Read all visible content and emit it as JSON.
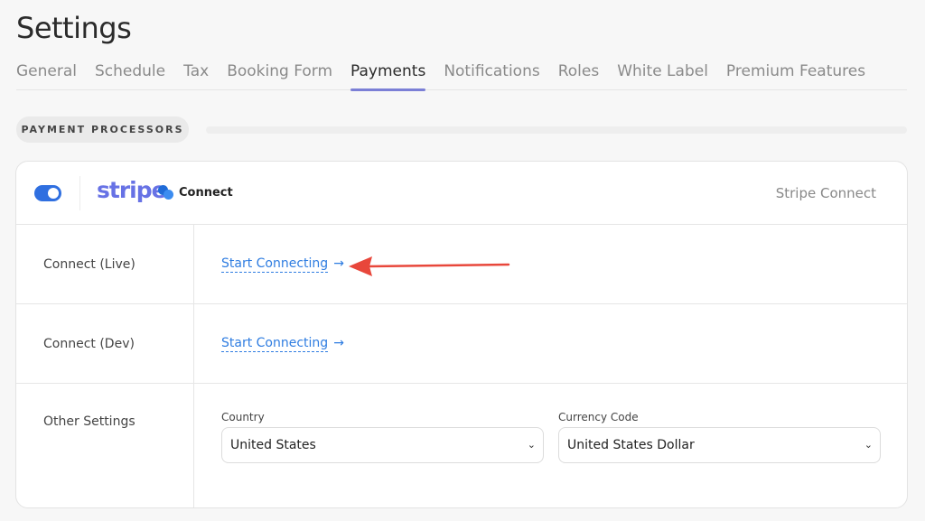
{
  "page": {
    "title": "Settings"
  },
  "tabs": [
    {
      "label": "General",
      "active": false
    },
    {
      "label": "Schedule",
      "active": false
    },
    {
      "label": "Tax",
      "active": false
    },
    {
      "label": "Booking Form",
      "active": false
    },
    {
      "label": "Payments",
      "active": true
    },
    {
      "label": "Notifications",
      "active": false
    },
    {
      "label": "Roles",
      "active": false
    },
    {
      "label": "White Label",
      "active": false
    },
    {
      "label": "Premium Features",
      "active": false
    }
  ],
  "section": {
    "label": "PAYMENT PROCESSORS"
  },
  "processor": {
    "enabled": true,
    "logo_text": "stripe",
    "badge_text": "Connect",
    "name": "Stripe Connect",
    "colors": {
      "logo": "#6772e5",
      "link": "#2f7de1",
      "toggle": "#2f6fe0",
      "annotation_arrow": "#e8473b"
    }
  },
  "rows": {
    "live": {
      "label": "Connect (Live)",
      "link": "Start Connecting",
      "arrow": "→"
    },
    "dev": {
      "label": "Connect (Dev)",
      "link": "Start Connecting",
      "arrow": "→"
    },
    "other": {
      "label": "Other Settings",
      "country": {
        "label": "Country",
        "value": "United States"
      },
      "currency": {
        "label": "Currency Code",
        "value": "United States Dollar"
      }
    }
  },
  "icons": {
    "dropdown": "chevron-down-icon",
    "annotation": "red-arrow-icon"
  }
}
